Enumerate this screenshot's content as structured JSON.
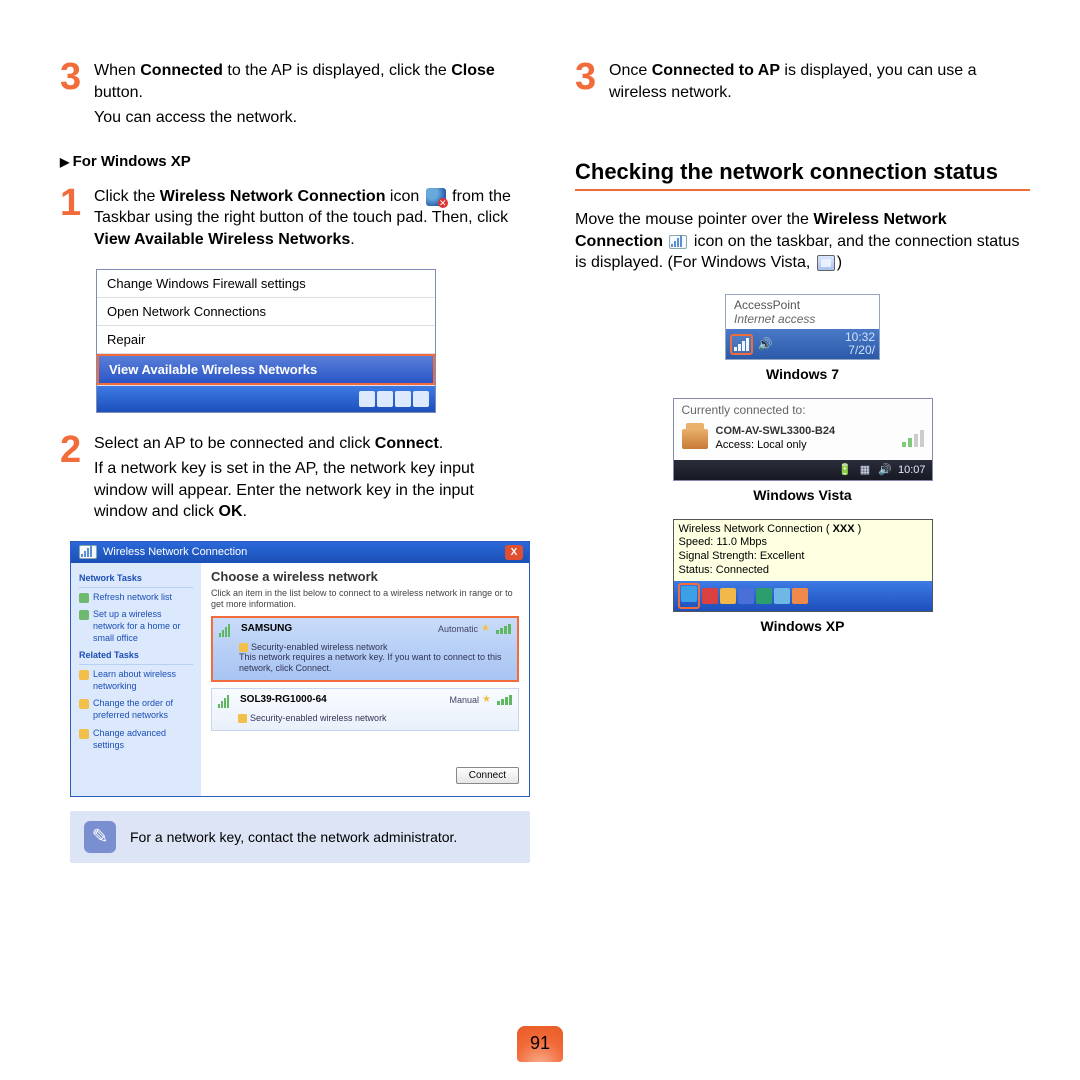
{
  "page_number": "91",
  "left": {
    "top_step": {
      "num": "3",
      "text_a": "When ",
      "text_b": "Connected",
      "text_c": " to the AP is displayed, click the ",
      "text_d": "Close",
      "text_e": " button.",
      "text_f": "You can access the network."
    },
    "subheading": "For Windows XP",
    "step1": {
      "num": "1",
      "a": "Click the ",
      "b": "Wireless Network Connection",
      "c": " icon ",
      "d": " from the Taskbar using the right button of the touch pad. Then, click ",
      "e": "View Available Wireless Networks",
      "f": "."
    },
    "context_menu": {
      "items": [
        "Change Windows Firewall settings",
        "Open Network Connections",
        "Repair"
      ],
      "highlight": "View Available Wireless Networks"
    },
    "step2": {
      "num": "2",
      "a": "Select an AP to be connected and click ",
      "b": "Connect",
      "c": ".",
      "d": "If a network key is set in the AP, the network key input window will appear. Enter the network key in the input window and click ",
      "e": "OK",
      "f": "."
    },
    "wnc": {
      "title": "Wireless Network Connection",
      "side": {
        "h1": "Network Tasks",
        "l1": "Refresh network list",
        "l2": "Set up a wireless network for a home or small office",
        "h2": "Related Tasks",
        "l3": "Learn about wireless networking",
        "l4": "Change the order of preferred networks",
        "l5": "Change advanced settings"
      },
      "main_h": "Choose a wireless network",
      "main_sub": "Click an item in the list below to connect to a wireless network in range or to get more information.",
      "net1": {
        "name": "SAMSUNG",
        "mode": "Automatic",
        "sec": "Security-enabled wireless network",
        "msg": "This network requires a network key. If you want to connect to this network, click Connect."
      },
      "net2": {
        "name": "SOL39-RG1000-64",
        "mode": "Manual",
        "sec": "Security-enabled wireless network"
      },
      "connect": "Connect"
    },
    "note": "For a network key, contact the network administrator."
  },
  "right": {
    "top_step": {
      "num": "3",
      "a": "Once ",
      "b": "Connected to AP",
      "c": " is displayed, you can use a wireless network."
    },
    "section_title": "Checking the network connection status",
    "para_a": "Move the mouse pointer over the ",
    "para_b": "Wireless Network Connection",
    "para_c": " icon on the taskbar, and the connection status is displayed. (For Windows Vista, ",
    "para_d": ")",
    "w7": {
      "line1": "AccessPoint",
      "line2": "Internet access",
      "time": "10:32",
      "date": "7/20/",
      "caption": "Windows 7"
    },
    "vista": {
      "top": "Currently connected to:",
      "name": "COM-AV-SWL3300-B24",
      "access": "Access:  Local only",
      "time": "10:07",
      "caption": "Windows Vista"
    },
    "xp": {
      "l1a": "Wireless Network Connection ( ",
      "l1b": "XXX",
      "l1c": " )",
      "l2": "Speed: 11.0 Mbps",
      "l3": "Signal Strength: Excellent",
      "l4": "Status:  Connected",
      "caption": "Windows XP"
    }
  }
}
